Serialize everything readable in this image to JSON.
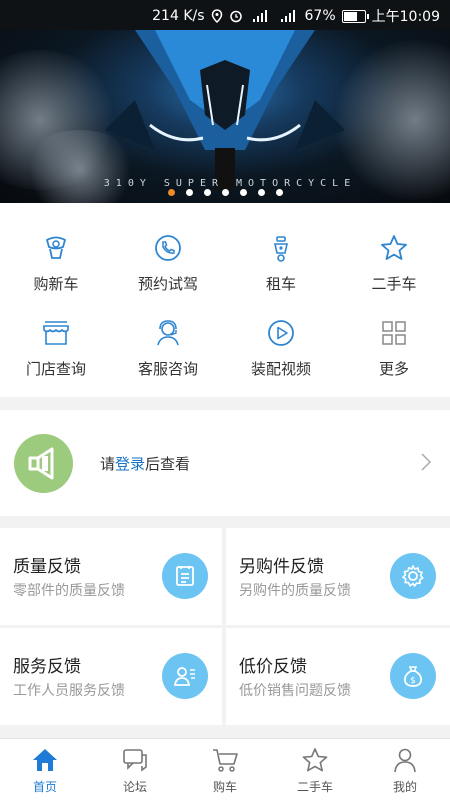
{
  "status_bar": {
    "speed": "214 K/s",
    "battery": "67%",
    "time": "上午10:09",
    "battery_level": 0.67
  },
  "banner": {
    "tagline": "310Y SUPER MOTORCYCLE",
    "page_count": 7,
    "active_page": 0
  },
  "menu": {
    "items": [
      {
        "label": "购新车",
        "icon": "new-bike-icon"
      },
      {
        "label": "预约试驾",
        "icon": "phone-icon"
      },
      {
        "label": "租车",
        "icon": "scooter-icon"
      },
      {
        "label": "二手车",
        "icon": "star-icon"
      },
      {
        "label": "门店查询",
        "icon": "store-icon"
      },
      {
        "label": "客服咨询",
        "icon": "headset-icon"
      },
      {
        "label": "装配视频",
        "icon": "play-icon"
      },
      {
        "label": "更多",
        "icon": "grid-icon"
      }
    ]
  },
  "login": {
    "prefix": "请",
    "link": "登录",
    "suffix": "后查看"
  },
  "cards": [
    {
      "title": "质量反馈",
      "sub": "零部件的质量反馈",
      "icon": "document-icon"
    },
    {
      "title": "另购件反馈",
      "sub": "另购件的质量反馈",
      "icon": "gear-icon"
    },
    {
      "title": "服务反馈",
      "sub": "工作人员服务反馈",
      "icon": "staff-icon"
    },
    {
      "title": "低价反馈",
      "sub": "低价销售问题反馈",
      "icon": "money-bag-icon"
    }
  ],
  "tabs": [
    {
      "label": "首页",
      "icon": "home-icon",
      "active": true
    },
    {
      "label": "论坛",
      "icon": "forum-icon",
      "active": false
    },
    {
      "label": "购车",
      "icon": "cart-icon",
      "active": false
    },
    {
      "label": "二手车",
      "icon": "star-icon",
      "active": false
    },
    {
      "label": "我的",
      "icon": "user-icon",
      "active": false
    }
  ],
  "colors": {
    "accent": "#1f7bd6",
    "card_icon_bg": "#6cc4f3",
    "login_badge": "#9ccb7e",
    "dot_active": "#f08a28"
  }
}
